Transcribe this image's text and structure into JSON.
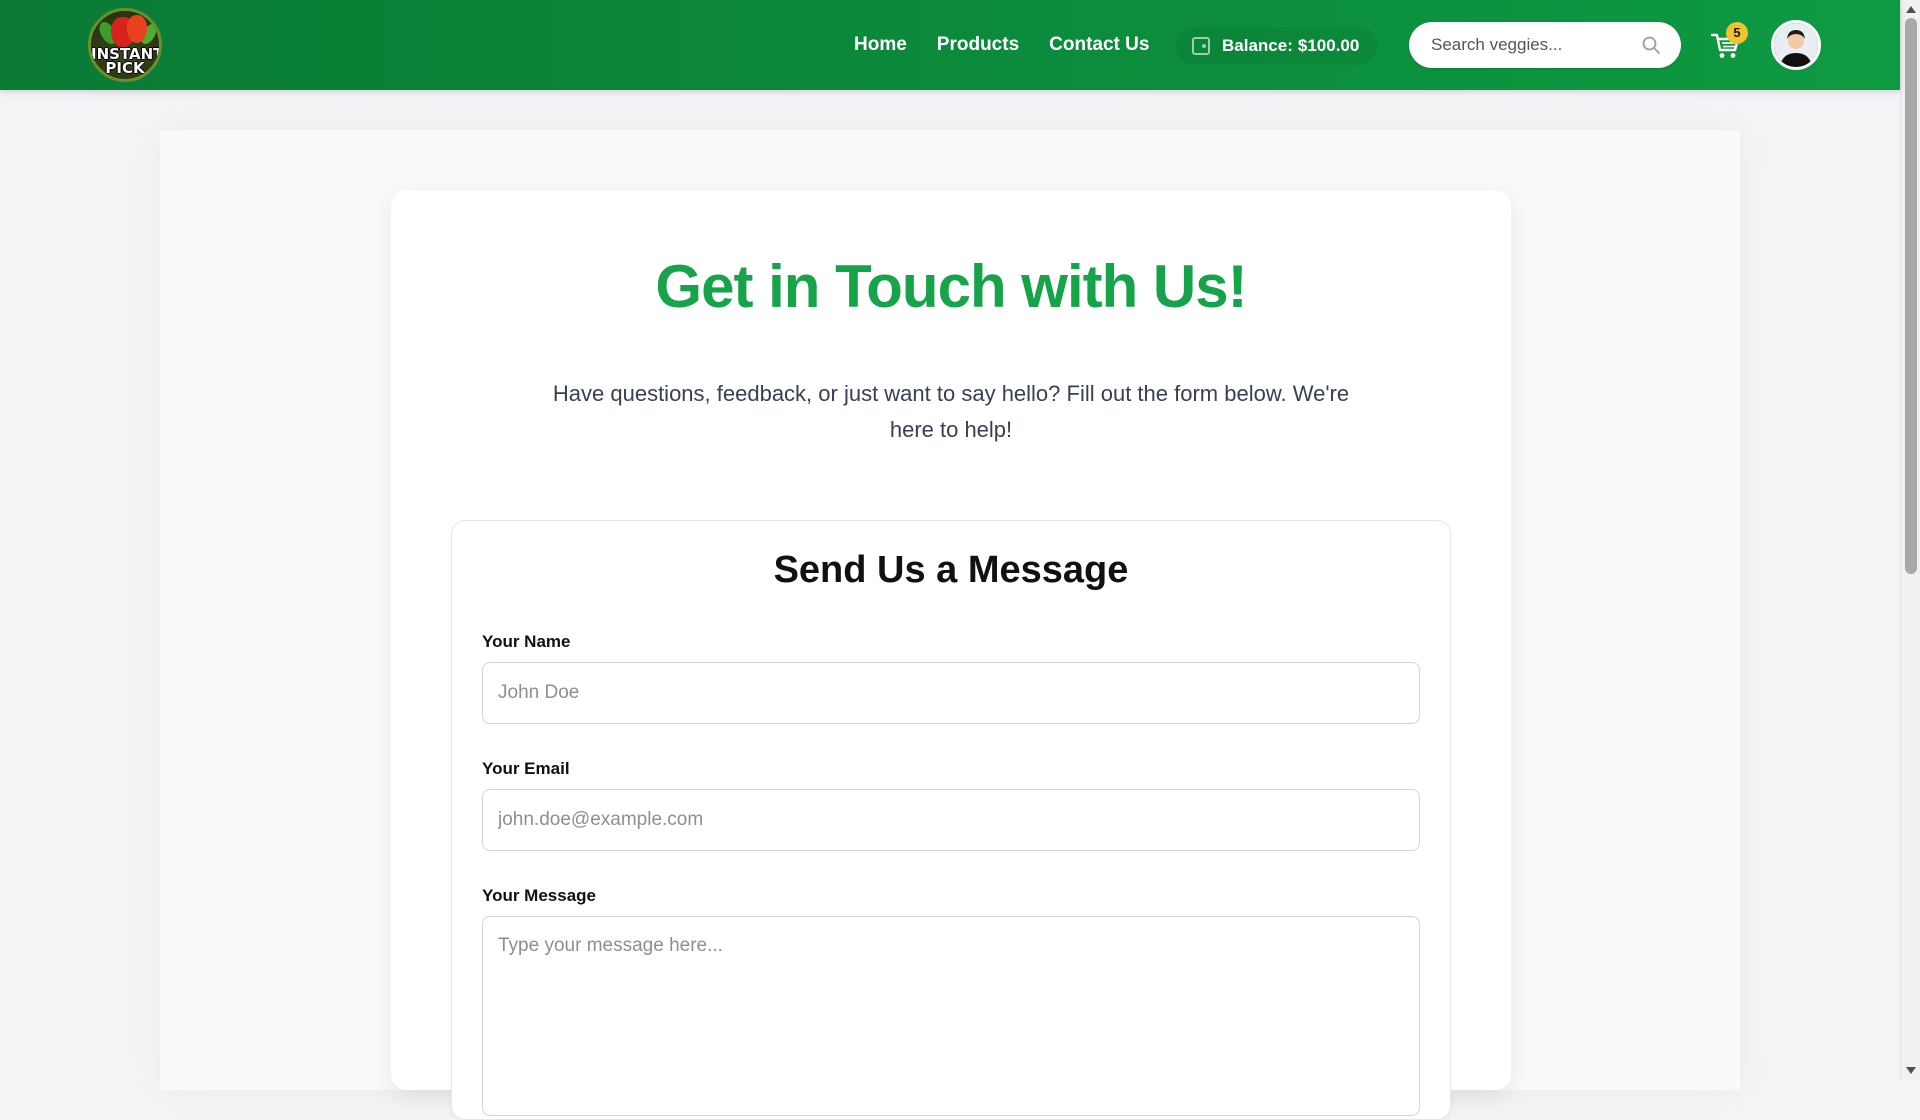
{
  "header": {
    "logo_text": "INSTANT PICK",
    "nav": [
      {
        "label": "Home"
      },
      {
        "label": "Products"
      },
      {
        "label": "Contact Us"
      }
    ],
    "balance": {
      "label": "Balance:",
      "value": "$100.00"
    },
    "search": {
      "placeholder": "Search veggies..."
    },
    "cart": {
      "count": "5"
    }
  },
  "page": {
    "title": "Get in Touch with Us!",
    "subtitle": "Have questions, feedback, or just want to say hello? Fill out the form below. We're here to help!"
  },
  "form": {
    "title": "Send Us a Message",
    "name": {
      "label": "Your Name",
      "placeholder": "John Doe",
      "value": ""
    },
    "email": {
      "label": "Your Email",
      "placeholder": "john.doe@example.com",
      "value": ""
    },
    "message": {
      "label": "Your Message",
      "placeholder": "Type your message here...",
      "value": ""
    }
  },
  "colors": {
    "header_green": "#0b8a3b",
    "title_green": "#16a34a",
    "badge_yellow": "#f2c230"
  },
  "icons": [
    "wallet-icon",
    "search-icon",
    "cart-icon",
    "avatar-icon"
  ]
}
